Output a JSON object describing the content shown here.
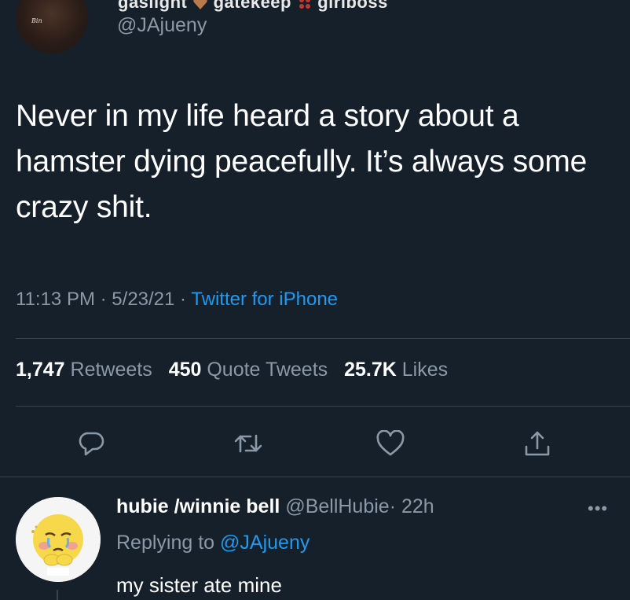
{
  "tweet": {
    "display_name": "gaslight",
    "display_name_extra": [
      "gatekeep",
      "girlboss"
    ],
    "handle": "@JAjueny",
    "avatar_signature": "Bin",
    "text": "Never in my life heard a story about a hamster dying peacefully. It’s always some crazy shit.",
    "time": "11:13 PM",
    "date": "5/23/21",
    "separator": "·",
    "source": "Twitter for iPhone",
    "stats": {
      "retweets_count": "1,747",
      "retweets_label": "Retweets",
      "quotes_count": "450",
      "quotes_label": "Quote Tweets",
      "likes_count": "25.7K",
      "likes_label": "Likes"
    },
    "actions": [
      "reply-icon",
      "retweet-icon",
      "like-icon",
      "share-icon"
    ]
  },
  "reply": {
    "name": "hubie /winnie bell",
    "handle": "@BellHubie",
    "separator": "·",
    "time": "22h",
    "replying_prefix": "Replying to",
    "replying_to": "@JAjueny",
    "text": "my sister ate mine",
    "more_icon": "more-icon"
  },
  "colors": {
    "background": "#15202b",
    "text": "#ffffff",
    "muted": "#8b98a5",
    "accent": "#1d9bf0",
    "divider": "#38444d"
  }
}
